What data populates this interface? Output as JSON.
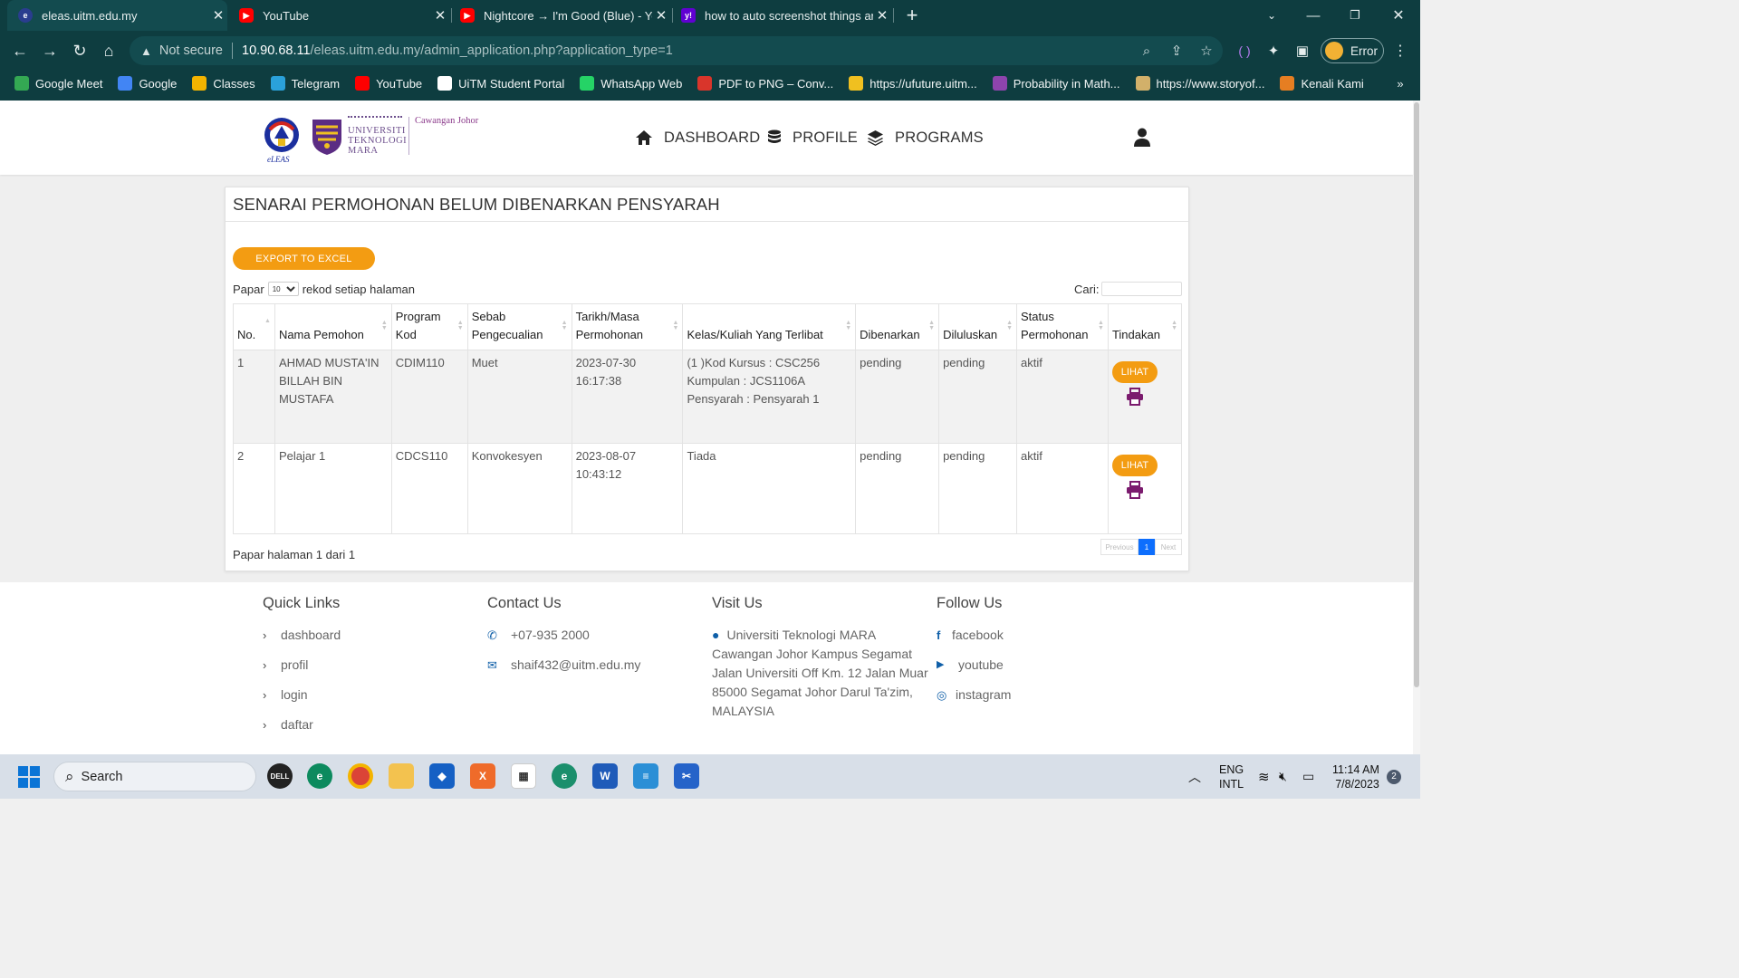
{
  "browser": {
    "tabs": [
      {
        "title": "eleas.uitm.edu.my",
        "active": true
      },
      {
        "title": "YouTube",
        "active": false
      },
      {
        "title": "Nightcore → I'm Good (Blue) - Yo",
        "active": false
      },
      {
        "title": "how to auto screenshot things ar",
        "active": false
      }
    ],
    "not_secure": "Not secure",
    "url_host": "10.90.68.11",
    "url_path": "/eleas.uitm.edu.my/admin_application.php?application_type=1",
    "profile_label": "Error",
    "bookmarks": [
      {
        "label": "Google Meet",
        "color": "#34a853"
      },
      {
        "label": "Google",
        "color": "#4285f4"
      },
      {
        "label": "Classes",
        "color": "#f4b400"
      },
      {
        "label": "Telegram",
        "color": "#2aa1da"
      },
      {
        "label": "YouTube",
        "color": "#ff0000"
      },
      {
        "label": "UiTM Student Portal",
        "color": "#ffffff"
      },
      {
        "label": "WhatsApp Web",
        "color": "#25d366"
      },
      {
        "label": "PDF to PNG – Conv...",
        "color": "#d9352b"
      },
      {
        "label": "https://ufuture.uitm...",
        "color": "#f0c020"
      },
      {
        "label": "Probability in Math...",
        "color": "#8e44ad"
      },
      {
        "label": "https://www.storyof...",
        "color": "#d2b06a"
      },
      {
        "label": "Kenali Kami",
        "color": "#e67e22"
      }
    ]
  },
  "site": {
    "logo_text": "eLEAS",
    "university_lines": [
      "UNIVERSITI",
      "TEKNOLOGI",
      "MARA"
    ],
    "cawangan": "Cawangan Johor",
    "nav": [
      {
        "label": "DASHBOARD",
        "icon": "home-icon"
      },
      {
        "label": "PROFILE",
        "icon": "database-icon"
      },
      {
        "label": "PROGRAMS",
        "icon": "layers-icon"
      }
    ]
  },
  "main": {
    "title": "SENARAI PERMOHONAN BELUM DIBENARKAN PENSYARAH",
    "export_label": "EXPORT TO EXCEL",
    "papar_label": "Papar",
    "page_size": "10",
    "rekod_label": "rekod setiap halaman",
    "cari_label": "Cari:",
    "columns": [
      "No.",
      "Nama Pemohon",
      "Program Kod",
      "Sebab Pengecualian",
      "Tarikh/Masa Permohonan",
      "Kelas/Kuliah Yang Terlibat",
      "Dibenarkan",
      "Diluluskan",
      "Status Permohonan",
      "Tindakan"
    ],
    "rows": [
      {
        "no": "1",
        "nama": "AHMAD MUSTA'IN BILLAH BIN MUSTAFA",
        "kod": "CDIM110",
        "sebab": "Muet",
        "tarikh": "2023-07-30 16:17:38",
        "kelas": [
          "(1 )Kod Kursus : CSC256",
          "Kumpulan : JCS1106A",
          "Pensyarah : Pensyarah 1"
        ],
        "dibenarkan": "pending",
        "diluluskan": "pending",
        "status": "aktif",
        "action": "LIHAT"
      },
      {
        "no": "2",
        "nama": "Pelajar 1",
        "kod": "CDCS110",
        "sebab": "Konvokesyen",
        "tarikh": "2023-08-07 10:43:12",
        "kelas": [
          "Tiada"
        ],
        "dibenarkan": "pending",
        "diluluskan": "pending",
        "status": "aktif",
        "action": "LIHAT"
      }
    ],
    "info": "Papar halaman 1 dari 1",
    "pager": {
      "prev": "Previous",
      "current": "1",
      "next": "Next"
    }
  },
  "footer": {
    "quick_links_title": "Quick Links",
    "quick_links": [
      "dashboard",
      "profil",
      "login",
      "daftar"
    ],
    "contact_title": "Contact Us",
    "phone": "+07-935 2000",
    "email": "shaif432@uitm.edu.my",
    "visit_title": "Visit Us",
    "address": "Universiti Teknologi MARA Cawangan Johor Kampus Segamat Jalan Universiti Off Km. 12 Jalan Muar 85000 Segamat Johor Darul Ta'zim, MALAYSIA",
    "follow_title": "Follow Us",
    "social": [
      "facebook",
      "youtube",
      "instagram"
    ]
  },
  "taskbar": {
    "search_label": "Search",
    "lang1": "ENG",
    "lang2": "INTL",
    "time": "11:14 AM",
    "date": "7/8/2023",
    "notif_count": "2"
  }
}
